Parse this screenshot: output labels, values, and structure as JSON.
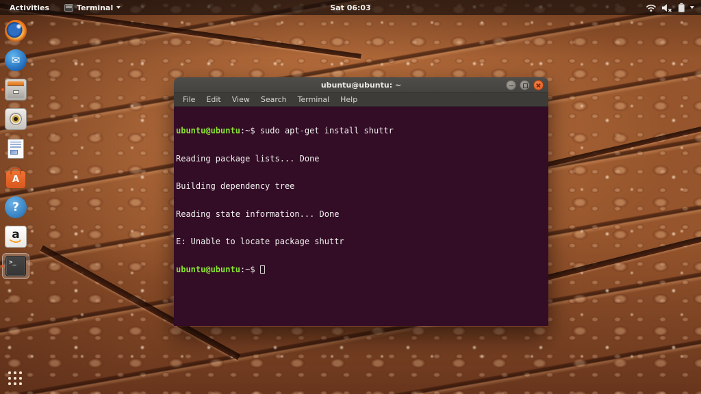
{
  "top_bar": {
    "activities": "Activities",
    "app_name": "Terminal",
    "clock": "Sat 06:03"
  },
  "dock": {
    "items": [
      {
        "name": "firefox",
        "running": false
      },
      {
        "name": "thunderbird",
        "running": false
      },
      {
        "name": "files",
        "running": true
      },
      {
        "name": "rhythmbox",
        "running": false
      },
      {
        "name": "libreoffice-writer",
        "running": false
      },
      {
        "name": "ubuntu-software",
        "running": false
      },
      {
        "name": "help",
        "running": false
      },
      {
        "name": "amazon",
        "running": false
      },
      {
        "name": "terminal",
        "running": true,
        "focused": true
      }
    ],
    "glyphs": {
      "thunderbird": "✉",
      "software": "A",
      "help": "?",
      "amazon": "a",
      "terminal": ">_"
    }
  },
  "window": {
    "title": "ubuntu@ubuntu: ~",
    "menu": [
      "File",
      "Edit",
      "View",
      "Search",
      "Terminal",
      "Help"
    ]
  },
  "terminal": {
    "prompt_user": "ubuntu@ubuntu",
    "prompt_suffix": ":~$",
    "command": "sudo apt-get install shuttr",
    "output": [
      "Reading package lists... Done",
      "Building dependency tree",
      "Reading state information... Done",
      "E: Unable to locate package shuttr"
    ],
    "colors": {
      "background": "#330c26",
      "foreground": "#f2f2f0",
      "prompt_green": "#8ae234"
    }
  },
  "colors": {
    "close_button": "#e0581e",
    "topbar_bg": "rgba(14,9,9,0.62)",
    "running_dot": "#e95420"
  }
}
